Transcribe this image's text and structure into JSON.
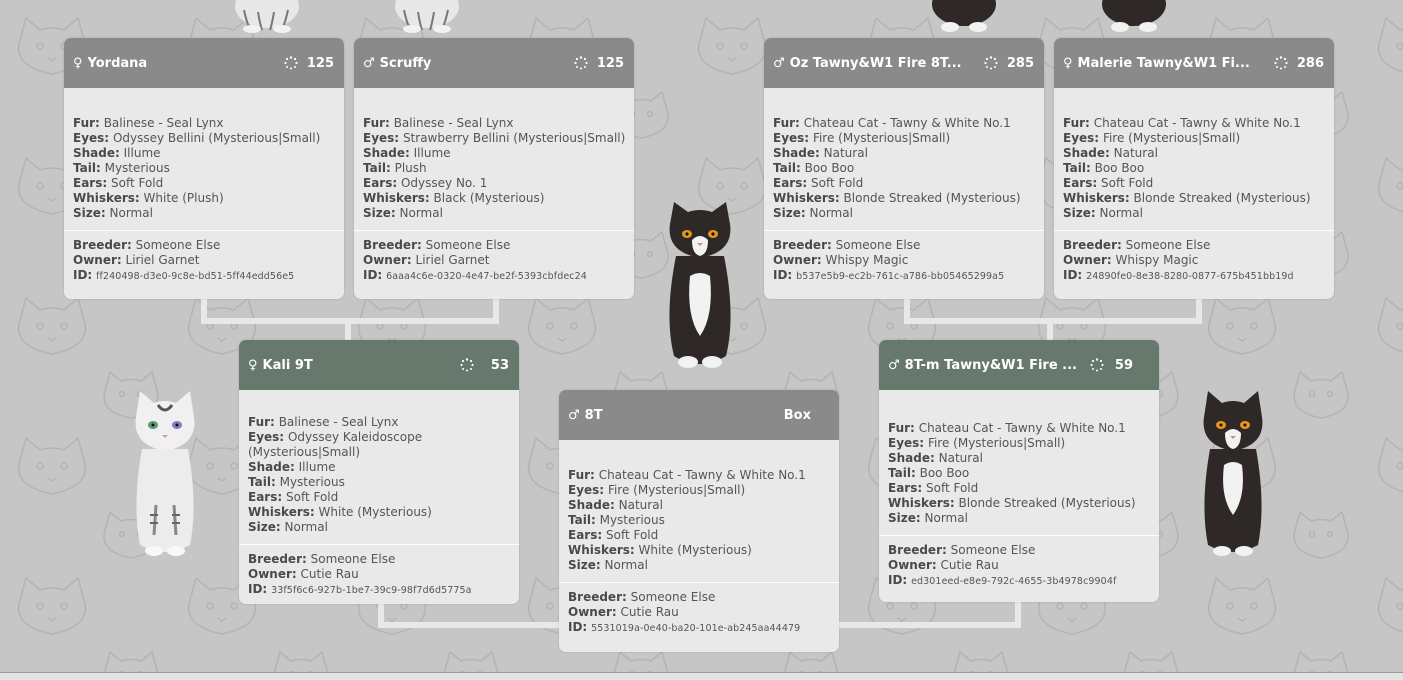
{
  "colors": {
    "background": "#c6c6c6",
    "header_grey": "#8a8a8a",
    "header_green": "#67786d",
    "card_body": "#e9e9e9",
    "connector": "#e8e8e8"
  },
  "labels": {
    "fur": "Fur:",
    "eyes": "Eyes:",
    "shade": "Shade:",
    "tail": "Tail:",
    "ears": "Ears:",
    "whiskers": "Whiskers:",
    "size": "Size:",
    "breeder": "Breeder:",
    "owner": "Owner:",
    "id": "ID:"
  },
  "icons": {
    "female": "♀",
    "male": "♂",
    "generation": "generation-spinner-icon"
  },
  "cards": {
    "yordana": {
      "gender": "♀",
      "name": "Yordana",
      "gen": "125",
      "fur": "Balinese - Seal Lynx",
      "eyes": "Odyssey Bellini (Mysterious|Small)",
      "shade": "Illume",
      "tail": "Mysterious",
      "ears": "Soft Fold",
      "whiskers": "White (Plush)",
      "size": "Normal",
      "breeder": "Someone Else",
      "owner": "Liriel Garnet",
      "id": "ff240498-d3e0-9c8e-bd51-5ff44edd56e5"
    },
    "scruffy": {
      "gender": "♂",
      "name": "Scruffy",
      "gen": "125",
      "fur": "Balinese - Seal Lynx",
      "eyes": "Strawberry Bellini (Mysterious|Small)",
      "shade": "Illume",
      "tail": "Plush",
      "ears": "Odyssey No. 1",
      "whiskers": "Black (Mysterious)",
      "size": "Normal",
      "breeder": "Someone Else",
      "owner": "Liriel Garnet",
      "id": "6aaa4c6e-0320-4e47-be2f-5393cbfdec24"
    },
    "oz": {
      "gender": "♂",
      "name": "Oz Tawny&W1 Fire 8T...",
      "gen": "285",
      "fur": "Chateau Cat - Tawny & White No.1",
      "eyes": "Fire (Mysterious|Small)",
      "shade": "Natural",
      "tail": "Boo Boo",
      "ears": "Soft Fold",
      "whiskers": "Blonde Streaked (Mysterious)",
      "size": "Normal",
      "breeder": "Someone Else",
      "owner": "Whispy Magic",
      "id": "b537e5b9-ec2b-761c-a786-bb05465299a5"
    },
    "malerie": {
      "gender": "♀",
      "name": "Malerie Tawny&W1 Fi...",
      "gen": "286",
      "fur": "Chateau Cat - Tawny & White No.1",
      "eyes": "Fire (Mysterious|Small)",
      "shade": "Natural",
      "tail": "Boo Boo",
      "ears": "Soft Fold",
      "whiskers": "Blonde Streaked (Mysterious)",
      "size": "Normal",
      "breeder": "Someone Else",
      "owner": "Whispy Magic",
      "id": "24890fe0-8e38-8280-0877-675b451bb19d"
    },
    "kali": {
      "gender": "♀",
      "name": "Kali 9T",
      "gen": "53",
      "fur": "Balinese - Seal Lynx",
      "eyes": "Odyssey Kaleidoscope (Mysterious|Small)",
      "shade": "Illume",
      "tail": "Mysterious",
      "ears": "Soft Fold",
      "whiskers": "White (Mysterious)",
      "size": "Normal",
      "breeder": "Someone Else",
      "owner": "Cutie Rau",
      "id": "33f5f6c6-927b-1be7-39c9-98f7d6d5775a"
    },
    "eightT": {
      "gender": "♂",
      "name": "8T",
      "box": "Box",
      "fur": "Chateau Cat - Tawny & White No.1",
      "eyes": "Fire (Mysterious|Small)",
      "shade": "Natural",
      "tail": "Mysterious",
      "ears": "Soft Fold",
      "whiskers": "White (Mysterious)",
      "size": "Normal",
      "breeder": "Someone Else",
      "owner": "Cutie Rau",
      "id": "5531019a-0e40-ba20-101e-ab245aa44479"
    },
    "eightTm": {
      "gender": "♂",
      "name": "8T-m Tawny&W1 Fire ...",
      "gen": "59",
      "fur": "Chateau Cat - Tawny & White No.1",
      "eyes": "Fire (Mysterious|Small)",
      "shade": "Natural",
      "tail": "Boo Boo",
      "ears": "Soft Fold",
      "whiskers": "Blonde Streaked (Mysterious)",
      "size": "Normal",
      "breeder": "Someone Else",
      "owner": "Cutie Rau",
      "id": "ed301eed-e8e9-792c-4655-3b4978c9904f"
    }
  }
}
